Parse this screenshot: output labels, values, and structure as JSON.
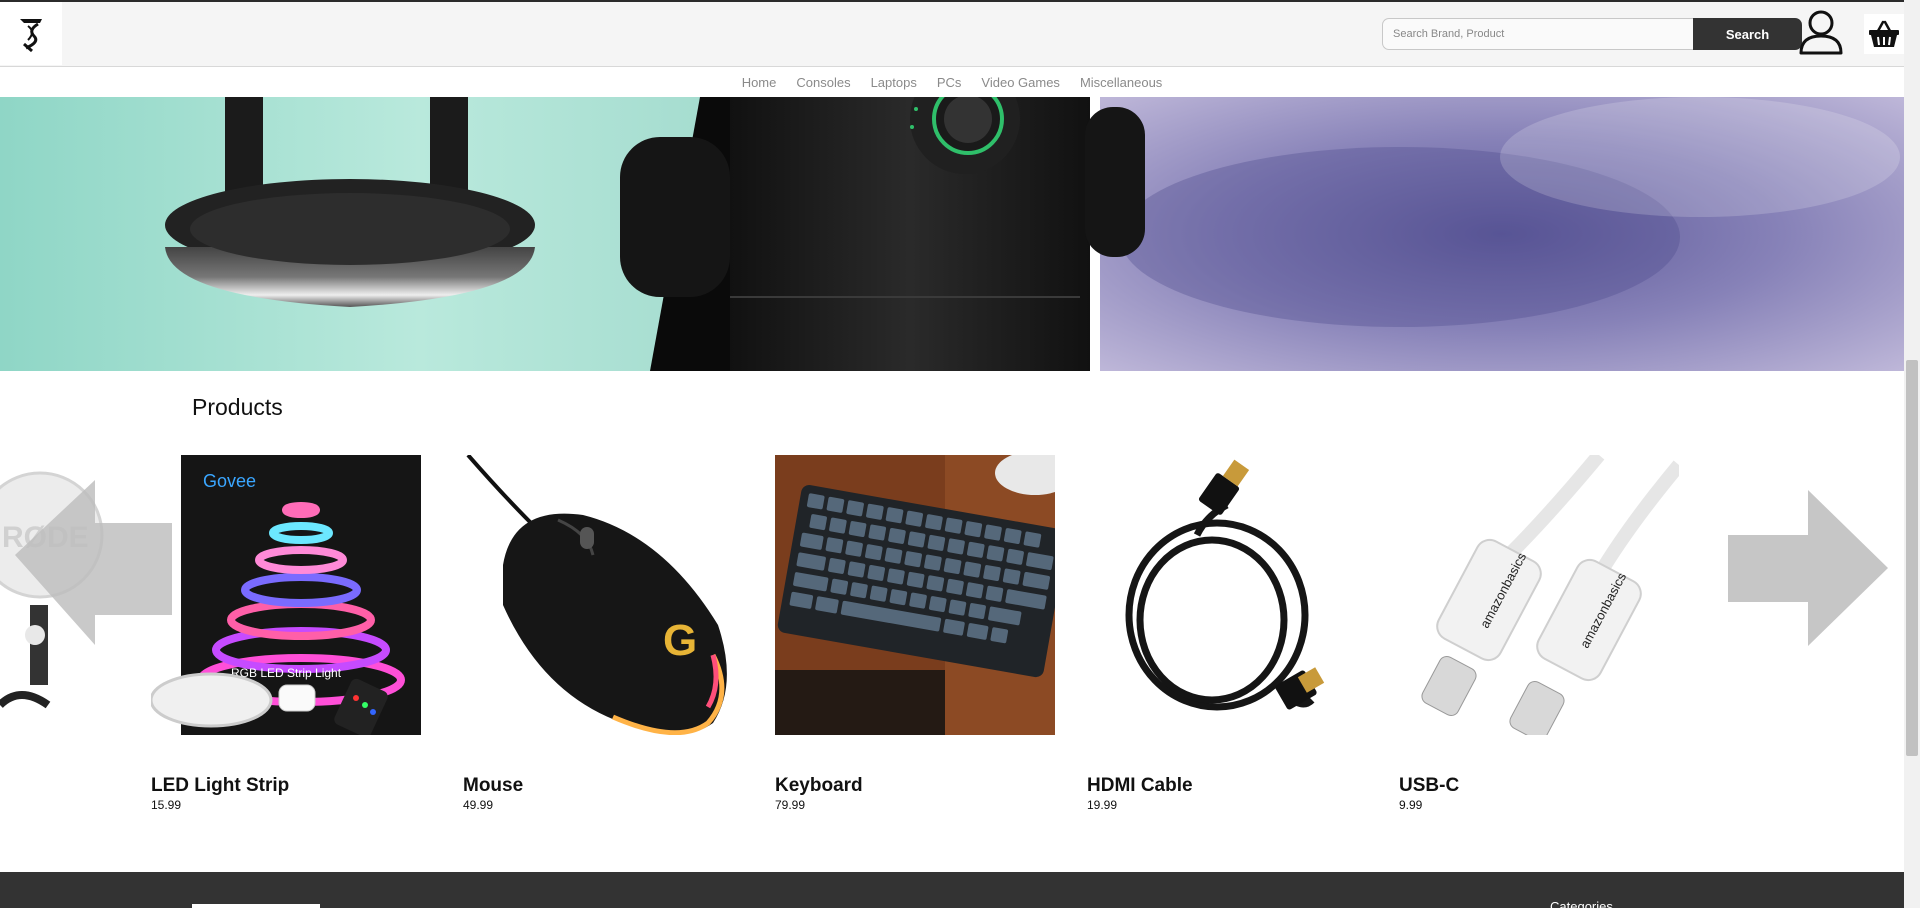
{
  "header": {
    "search": {
      "placeholder": "Search Brand, Product",
      "button_label": "Search"
    }
  },
  "nav": {
    "items": [
      {
        "label": "Home"
      },
      {
        "label": "Consoles"
      },
      {
        "label": "Laptops"
      },
      {
        "label": "PCs"
      },
      {
        "label": "Video Games"
      },
      {
        "label": "Miscellaneous"
      }
    ]
  },
  "products": {
    "title": "Products",
    "items": [
      {
        "name": "LED Light Strip",
        "price": "15.99",
        "icon": "led-strip-image"
      },
      {
        "name": "Mouse",
        "price": "49.99",
        "icon": "mouse-image"
      },
      {
        "name": "Keyboard",
        "price": "79.99",
        "icon": "keyboard-image"
      },
      {
        "name": "HDMI Cable",
        "price": "19.99",
        "icon": "hdmi-cable-image"
      },
      {
        "name": "USB-C",
        "price": "9.99",
        "icon": "usb-c-image"
      }
    ]
  },
  "footer": {
    "categories_label": "Categories"
  },
  "colors": {
    "header_bg": "#f5f5f5",
    "button_dark": "#333333",
    "footer_bg": "#333333",
    "nav_text": "#8a8a8a"
  }
}
